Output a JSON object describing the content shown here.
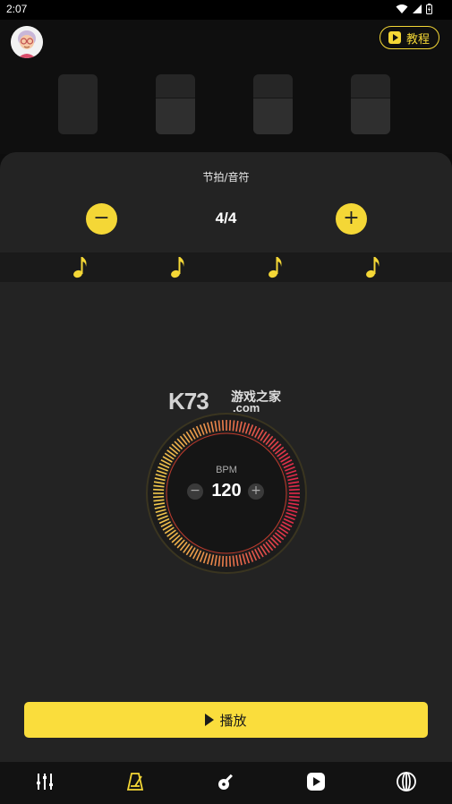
{
  "status_bar": {
    "time": "2:07"
  },
  "header": {
    "tutorial_label": "教程"
  },
  "meter": {
    "title": "节拍/音符",
    "time_signature": "4/4",
    "decrease_label": "−",
    "increase_label": "+",
    "beats": [
      {
        "accent": true
      },
      {
        "accent": false
      },
      {
        "accent": false
      },
      {
        "accent": false
      }
    ]
  },
  "watermark": {
    "brand": "K73",
    "cn": "游戏之家",
    "domain": ".com"
  },
  "tempo": {
    "label": "BPM",
    "value": "120",
    "minus_label": "−",
    "plus_label": "+"
  },
  "play_button": {
    "label": "播放"
  },
  "tabs": [
    {
      "name": "tuner",
      "icon": "sliders-icon",
      "active": false
    },
    {
      "name": "metronome",
      "icon": "metronome-icon",
      "active": true
    },
    {
      "name": "guitar",
      "icon": "guitar-icon",
      "active": false
    },
    {
      "name": "video",
      "icon": "play-icon",
      "active": false
    },
    {
      "name": "more",
      "icon": "globe-icon",
      "active": false
    }
  ],
  "colors": {
    "accent": "#f4d736",
    "panel": "#232323",
    "dial_start": "#f2c94c",
    "dial_end": "#e0284a"
  }
}
